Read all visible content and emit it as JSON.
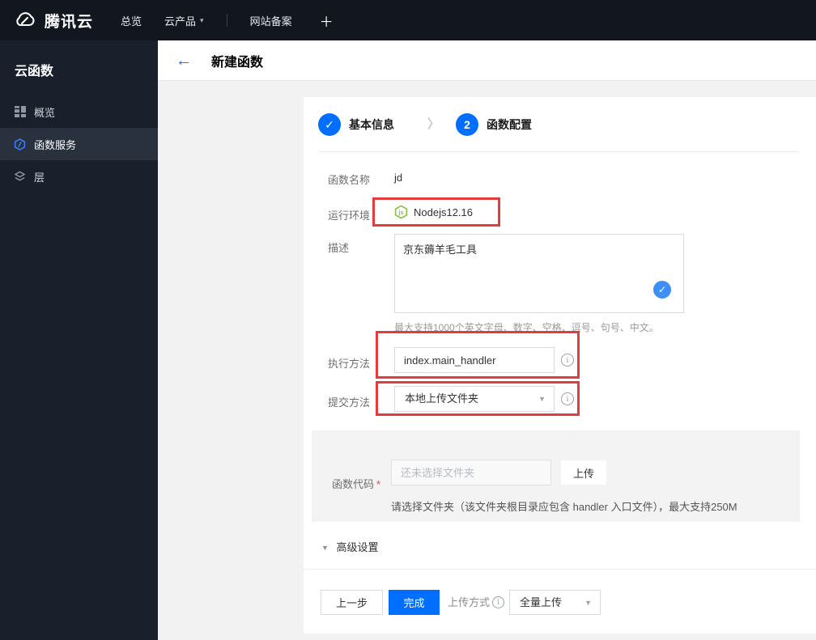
{
  "topbar": {
    "brand": "腾讯云",
    "nav": [
      {
        "label": "总览",
        "has_caret": false
      },
      {
        "label": "云产品",
        "has_caret": true
      },
      {
        "label": "网站备案",
        "has_caret": false
      }
    ],
    "plus": "＋"
  },
  "sidebar": {
    "title": "云函数",
    "items": [
      {
        "label": "概览",
        "icon": "grid-icon",
        "active": false
      },
      {
        "label": "函数服务",
        "icon": "function-hexagon-icon",
        "active": true
      },
      {
        "label": "层",
        "icon": "layers-icon",
        "active": false
      }
    ]
  },
  "header": {
    "back": "←",
    "title": "新建函数"
  },
  "steps": [
    {
      "num": "✓",
      "label": "基本信息",
      "state": "done"
    },
    {
      "num": "2",
      "label": "函数配置",
      "state": "current"
    }
  ],
  "steps_chevron": "〉",
  "form": {
    "name": {
      "label": "函数名称",
      "value": "jd"
    },
    "runtime": {
      "label": "运行环境",
      "value": "Nodejs12.16",
      "icon": "nodejs-icon"
    },
    "desc": {
      "label": "描述",
      "value": "京东薅羊毛工具",
      "hint": "最大支持1000个英文字母、数字、空格、逗号、句号、中文。",
      "valid_check": "✓"
    },
    "handler": {
      "label": "执行方法",
      "value": "index.main_handler",
      "info": "i"
    },
    "submit_method": {
      "label": "提交方法",
      "value": "本地上传文件夹",
      "caret": "▼",
      "info": "i"
    },
    "code": {
      "label": "函数代码",
      "required": "*",
      "placeholder": "还未选择文件夹",
      "upload_button": "上传",
      "hint": "请选择文件夹（该文件夹根目录应包含 handler 入口文件），最大支持250M"
    },
    "advanced": {
      "label": "高级设置",
      "caret": "▼"
    }
  },
  "footer": {
    "prev": "上一步",
    "finish": "完成",
    "upload_mode_label": "上传方式",
    "upload_mode_info": "i",
    "upload_mode_value": "全量上传",
    "caret": "▼"
  },
  "colors": {
    "accent_blue": "#006eff",
    "annotation_red": "#e23c3c",
    "node_green": "#83c045",
    "topbar_bg": "#12161e",
    "sidebar_bg": "#1a202b"
  }
}
